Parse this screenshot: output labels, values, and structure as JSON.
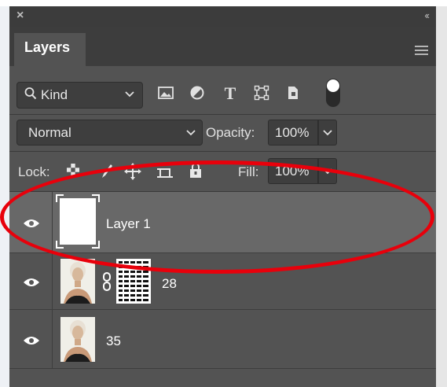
{
  "panel": {
    "close_glyph": "×",
    "collapse_glyph": "‹‹",
    "tab_label": "Layers",
    "menu_icon": "hamburger-icon"
  },
  "filter": {
    "search_icon": "search-icon",
    "kind_label": "Kind",
    "icons": [
      "image-filter-icon",
      "adjustment-filter-icon",
      "type-filter-icon",
      "shape-filter-icon",
      "smart-object-filter-icon"
    ],
    "type_glyph": "T",
    "toggle_state": "on"
  },
  "blend": {
    "mode": "Normal",
    "opacity_label": "Opacity:",
    "opacity_value": "100%"
  },
  "lock": {
    "label": "Lock:",
    "icons": [
      "lock-transparent-pixels-icon",
      "lock-image-pixels-icon",
      "lock-position-icon",
      "prevent-auto-nesting-icon",
      "lock-all-icon"
    ],
    "fill_label": "Fill:",
    "fill_value": "100%"
  },
  "layers": [
    {
      "name": "Layer 1",
      "visible": true,
      "selected": true,
      "thumbnail": "blank-white"
    },
    {
      "name": "28",
      "visible": true,
      "selected": false,
      "thumbnail": "portrait-photo",
      "has_mask": true,
      "mask": "halftone-pattern"
    },
    {
      "name": "35",
      "visible": true,
      "selected": false,
      "thumbnail": "portrait-photo"
    }
  ],
  "annotation": {
    "color": "#e8000b",
    "shape": "ellipse",
    "target": "Layer 1"
  },
  "colors": {
    "panel_bg": "#535353",
    "selected_row": "#686868",
    "titlebar": "#3c3c3c",
    "control_bg": "#3e3e3e",
    "text": "#ffffff"
  }
}
